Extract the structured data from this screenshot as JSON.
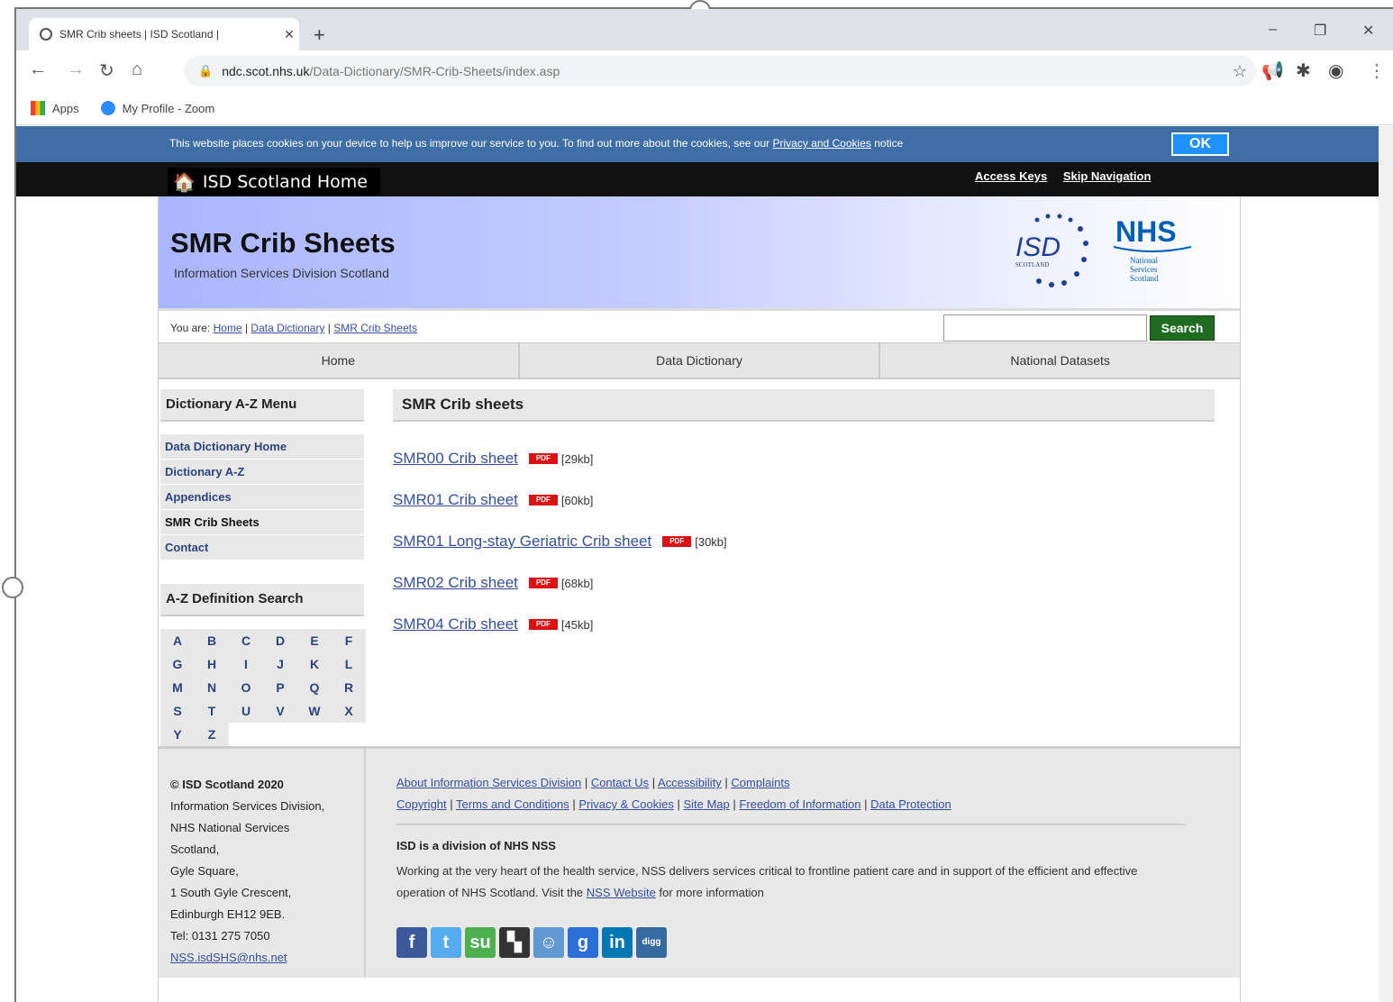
{
  "browser": {
    "tab_title": "SMR Crib sheets | ISD Scotland |",
    "tab_close": "✕",
    "new_tab": "+",
    "url_host": "ndc.scot.nhs.uk",
    "url_path": "/Data-Dictionary/SMR-Crib-Sheets/index.asp",
    "bookmarks": [
      "Apps",
      "My Profile - Zoom"
    ]
  },
  "cookie_bar": {
    "text": "This website places cookies on your device to help us improve our service to you. To find out more about the cookies, see our",
    "link": "Privacy and Cookies",
    "suffix": "notice",
    "ok": "OK"
  },
  "top_nav": {
    "home": "ISD Scotland Home",
    "access_keys": "Access Keys",
    "skip_nav": "Skip Navigation"
  },
  "banner": {
    "title": "SMR Crib Sheets",
    "subtitle": "Information Services Division Scotland",
    "isd_logo_text": "ISD",
    "isd_logo_sub": "SCOTLAND",
    "nhs_logo_text": "NHS",
    "nhs_logo_sub": [
      "National",
      "Services",
      "Scotland"
    ]
  },
  "breadcrumb": {
    "prefix": "You are:",
    "items": [
      "Home",
      "Data Dictionary",
      "SMR Crib Sheets"
    ],
    "separator": " | "
  },
  "search": {
    "button": "Search",
    "value": ""
  },
  "main_nav": [
    "Home",
    "Data Dictionary",
    "National Datasets"
  ],
  "sidebar": {
    "menu_title": "Dictionary A-Z Menu",
    "items": [
      "Data Dictionary Home",
      "Dictionary A-Z",
      "Appendices",
      "SMR Crib Sheets",
      "Contact"
    ],
    "az_title": "A-Z Definition Search",
    "letters": [
      "A",
      "B",
      "C",
      "D",
      "E",
      "F",
      "G",
      "H",
      "I",
      "J",
      "K",
      "L",
      "M",
      "N",
      "O",
      "P",
      "Q",
      "R",
      "S",
      "T",
      "U",
      "V",
      "W",
      "X",
      "Y",
      "Z"
    ]
  },
  "content": {
    "title": "SMR Crib sheets",
    "files": [
      {
        "name": "SMR00 Crib sheet",
        "badge": "PDF",
        "size": "[29kb]"
      },
      {
        "name": "SMR01 Crib sheet",
        "badge": "PDF",
        "size": "[60kb]"
      },
      {
        "name": "SMR01 Long-stay Geriatric Crib sheet",
        "badge": "PDF",
        "size": "[30kb]"
      },
      {
        "name": "SMR02 Crib sheet",
        "badge": "PDF",
        "size": "[68kb]"
      },
      {
        "name": "SMR04 Crib sheet",
        "badge": "PDF",
        "size": "[45kb]"
      }
    ]
  },
  "footer": {
    "org": "© ISD Scotland 2020",
    "address": [
      "Information Services Division,",
      "NHS National Services",
      "Scotland,",
      "Gyle Square,",
      "1 South Gyle Crescent,",
      "Edinburgh EH12 9EB.",
      "Tel: 0131 275 7050"
    ],
    "email": "NSS.isdSHS@nhs.net",
    "links_row1": [
      "About Information Services Division",
      "Contact Us",
      "Accessibility",
      "Complaints"
    ],
    "links_row2": [
      "Copyright",
      "Terms and Conditions",
      "Privacy & Cookies",
      "Site Map",
      "Freedom of Information",
      "Data Protection"
    ],
    "nss_heading": "ISD is a division of NHS NSS",
    "nss_text_pre": "Working at the very heart of the health service, NSS delivers services critical to frontline patient care and in support of the efficient and effective operation of NHS Scotland. Visit the",
    "nss_link": "NSS Website",
    "nss_text_post": "for more information",
    "social": [
      "facebook-icon",
      "twitter-icon",
      "stumbleupon-icon",
      "delicious-icon",
      "reddit-icon",
      "google-icon",
      "linkedin-icon",
      "digg-icon"
    ]
  }
}
